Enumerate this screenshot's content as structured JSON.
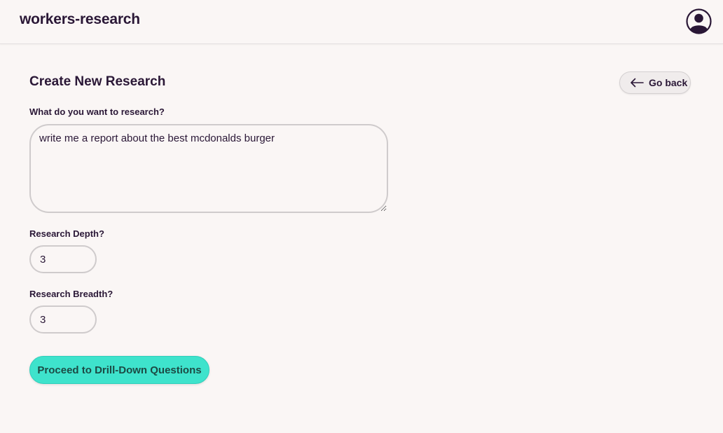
{
  "header": {
    "app_title": "workers-research",
    "avatar_icon": "user-circle-icon"
  },
  "page": {
    "title": "Create New Research",
    "go_back_label": "Go back",
    "go_back_icon": "arrow-left-icon"
  },
  "form": {
    "topic": {
      "label": "What do you want to research?",
      "value": "write me a report about the best mcdonalds burger"
    },
    "depth": {
      "label": "Research Depth?",
      "value": "3"
    },
    "breadth": {
      "label": "Research Breadth?",
      "value": "3"
    },
    "submit_label": "Proceed to Drill-Down Questions"
  },
  "colors": {
    "background": "#faf6f5",
    "text": "#2a1736",
    "accent": "#3ee3cc",
    "border": "#cfcbcc"
  }
}
